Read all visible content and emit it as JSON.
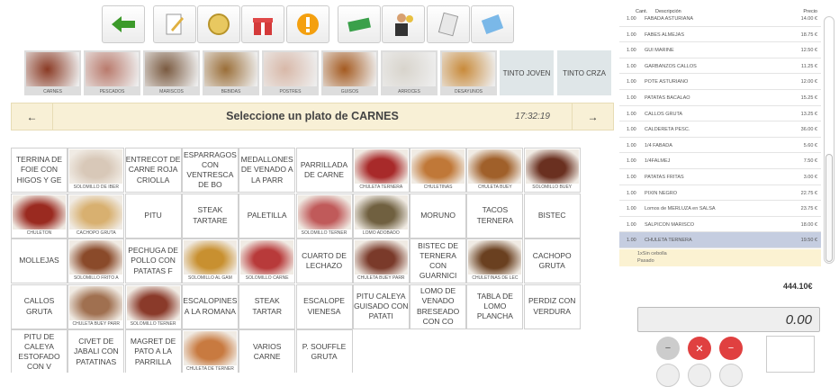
{
  "categories": [
    {
      "label": "CARNES",
      "bg": "#8a3a24"
    },
    {
      "label": "PESCADOS",
      "bg": "#b97a6c"
    },
    {
      "label": "MARISCOS",
      "bg": "#7a5a40"
    },
    {
      "label": "BEBIDAS",
      "bg": "#9a6e38"
    },
    {
      "label": "POSTRES",
      "bg": "#d8b8a8"
    },
    {
      "label": "GUISOS",
      "bg": "#a45a20"
    },
    {
      "label": "ARROCES",
      "bg": "#d8d4cc"
    },
    {
      "label": "DESAYUNOS",
      "bg": "#c88a3a"
    }
  ],
  "text_categories": [
    "TINTO JOVEN",
    "TINTO CRZA"
  ],
  "header": {
    "title": "Seleccione un plato de CARNES",
    "clock": "17:32:19",
    "prev": "←",
    "next": "→"
  },
  "items": [
    {
      "t": "TERRINA DE FOIE CON HIGOS Y GE"
    },
    {
      "cap": "SOLOMILLO DE IBER",
      "bg": "#d8c8b8"
    },
    {
      "t": "ENTRECOT DE CARNE ROJA CRIOLLA"
    },
    {
      "t": "ESPARRAGOS CON VENTRESCA DE BO"
    },
    {
      "t": "MEDALLONES DE VENADO A LA PARR"
    },
    {
      "t": "PARRILLADA DE CARNE"
    },
    {
      "cap": "CHULETA TERNERA",
      "bg": "#a82a2a"
    },
    {
      "cap": "CHULETINAS",
      "bg": "#c07838"
    },
    {
      "cap": "CHULETA BUEY",
      "bg": "#a0602a"
    },
    {
      "cap": "SOLOMILLO BUEY",
      "bg": "#6a3020"
    },
    {
      "cap": "CHULETON",
      "bg": "#9a2a20"
    },
    {
      "cap": "CACHOPO GRUTA",
      "bg": "#d8b070"
    },
    {
      "t": "PITU"
    },
    {
      "t": "STEAK TARTARE"
    },
    {
      "t": "PALETILLA"
    },
    {
      "cap": "SOLOMILLO TERNER",
      "bg": "#c05a5a"
    },
    {
      "cap": "LOMO ADOBADO",
      "bg": "#706040"
    },
    {
      "t": "MORUNO"
    },
    {
      "t": "TACOS TERNERA"
    },
    {
      "t": "BISTEC"
    },
    {
      "t": "MOLLEJAS"
    },
    {
      "cap": "SOLOMILLO FRITO A",
      "bg": "#8a4a2a"
    },
    {
      "t": "PECHUGA DE POLLO CON PATATAS F"
    },
    {
      "cap": "SOLOMILLO AL GAM",
      "bg": "#c89030"
    },
    {
      "cap": "SOLOMILLO CARNE",
      "bg": "#b83a3a"
    },
    {
      "t": "CUARTO DE LECHAZO"
    },
    {
      "cap": "CHULETA BUEY PARR",
      "bg": "#7a3a2a"
    },
    {
      "t": "BISTEC DE TERNERA CON GUARNICI"
    },
    {
      "cap": "CHULETINAS DE LEC",
      "bg": "#6a4020"
    },
    {
      "t": "CACHOPO GRUTA"
    },
    {
      "t": "CALLOS GRUTA"
    },
    {
      "cap": "CHULETA BUEY PARR",
      "bg": "#a07050"
    },
    {
      "cap": "SOLOMILLO TERNER",
      "bg": "#8a3a2a"
    },
    {
      "t": "ESCALOPINES A LA ROMANA"
    },
    {
      "t": "STEAK TARTAR"
    },
    {
      "t": "ESCALOPE VIENESA"
    },
    {
      "t": "PITU CALEYA GUISADO CON PATATI"
    },
    {
      "t": "LOMO DE VENADO BRESEADO CON CO"
    },
    {
      "t": "TABLA DE LOMO PLANCHA"
    },
    {
      "t": "PERDIZ CON VERDURA"
    },
    {
      "t": "PITU DE CALEYA ESTOFADO CON V"
    },
    {
      "t": "CIVET DE JABALI CON PATATINAS"
    },
    {
      "t": "MAGRET DE PATO A LA PARRILLA"
    },
    {
      "cap": "CHULETA DE TERNER",
      "bg": "#c87a40"
    },
    {
      "t": "VARIOS CARNE"
    },
    {
      "t": "P. SOUFFLE GRUTA"
    }
  ],
  "ticket": {
    "headers": {
      "qty": "Cant.",
      "desc": "Descripción",
      "price": "Precio"
    },
    "lines": [
      {
        "q": "1.00",
        "d": "FABADA ASTURIANA",
        "p": "14.00 €"
      },
      {
        "q": "1.00",
        "d": "FABES ALMEJAS",
        "p": "18.75 €"
      },
      {
        "q": "1.00",
        "d": "GUI MARINE",
        "p": "12.50 €"
      },
      {
        "q": "1.00",
        "d": "GARBANZOS CALLOS",
        "p": "11.25 €"
      },
      {
        "q": "1.00",
        "d": "POTE ASTURIANO",
        "p": "12.00 €"
      },
      {
        "q": "1.00",
        "d": "PATATAS BACALAO",
        "p": "15.25 €"
      },
      {
        "q": "1.00",
        "d": "CALLOS GRUTA",
        "p": "13.25 €"
      },
      {
        "q": "1.00",
        "d": "CALDERETA PESC.",
        "p": "36.00 €"
      },
      {
        "q": "1.00",
        "d": "1/4 FABADA",
        "p": "5.60 €"
      },
      {
        "q": "1.00",
        "d": "1/4FALMEJ",
        "p": "7.50 €"
      },
      {
        "q": "1.00",
        "d": "PATATAS FRITAS",
        "p": "3.00 €"
      },
      {
        "q": "1.00",
        "d": "PIXIN NEGRO",
        "p": "22.75 €"
      },
      {
        "q": "1.00",
        "d": "Lomos de MERLUZA en SALSA",
        "p": "23.75 €"
      },
      {
        "q": "1.00",
        "d": "SALPICON MARISCO",
        "p": "18.00 €"
      },
      {
        "q": "1.00",
        "d": "CHULETA TERNERA",
        "p": "19.50 €"
      }
    ],
    "notes": [
      "1xSin cebolla",
      "Pasado"
    ],
    "total": "444.10€"
  },
  "display": "0.00",
  "calc": {
    "minus": "−",
    "x": "✕",
    "neg": "−"
  }
}
